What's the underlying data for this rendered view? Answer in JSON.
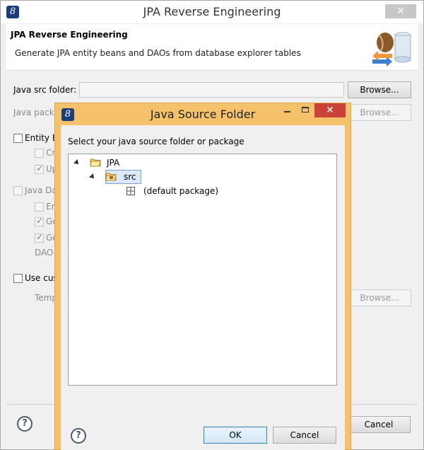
{
  "window": {
    "title": "JPA Reverse Engineering",
    "close_glyph": "✕",
    "app_icon_glyph": "8"
  },
  "banner": {
    "title": "JPA Reverse Engineering",
    "description": "Generate JPA entity beans and DAOs from database explorer tables",
    "icon": "beans-database-icon"
  },
  "form": {
    "java_src_folder_label": "Java src folder:",
    "java_src_folder_value": "",
    "java_package_label": "Java packa",
    "browse_label": "Browse...",
    "entity_bean_label": "Entity B",
    "entity_sub1": "Cr",
    "entity_sub2": "Up",
    "java_data_label": "Java Da",
    "java_data_sub1": "En",
    "java_data_sub2": "Ge",
    "java_data_sub3": "Ge",
    "dao_label": "DAO",
    "use_custom_label": "Use cus",
    "template_label": "Temp"
  },
  "footer": {
    "help_glyph": "?",
    "cancel_label": "Cancel"
  },
  "dialog": {
    "title": "Java Source Folder",
    "icon_glyph": "8",
    "close_glyph": "✕",
    "prompt": "Select your java source folder or package",
    "tree": [
      {
        "label": "JPA",
        "icon": "project-folder-icon",
        "expanded": true
      },
      {
        "label": "src",
        "icon": "source-folder-icon",
        "expanded": true,
        "selected": true
      },
      {
        "label": "(default package)",
        "icon": "package-icon"
      }
    ],
    "ok_label": "OK",
    "cancel_label": "Cancel",
    "help_glyph": "?"
  },
  "colors": {
    "dialog_frame": "#f5c26b",
    "dialog_close": "#c9423a",
    "selection": "#dbe8f8"
  }
}
